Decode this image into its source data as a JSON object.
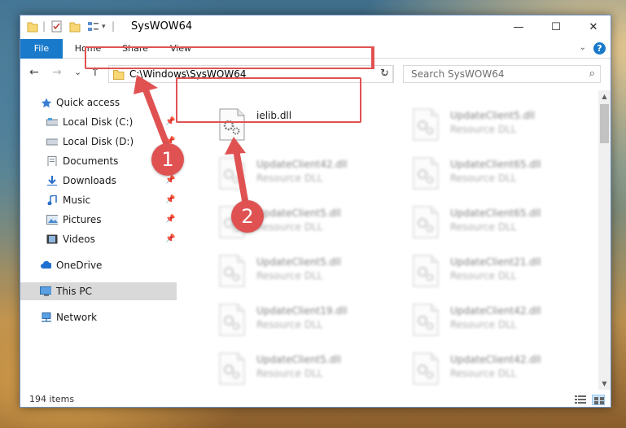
{
  "window": {
    "title": "SysWOW64",
    "minimize": "—",
    "maximize": "☐",
    "close": "✕"
  },
  "ribbon": {
    "tabs": [
      "File",
      "Home",
      "Share",
      "View"
    ],
    "expand": "⌄",
    "help": "?"
  },
  "nav": {
    "back": "←",
    "forward": "→",
    "recent": "⌄",
    "up": "↑",
    "address": "C:\\Windows\\SysWOW64",
    "address_dropdown": "⌄",
    "refresh": "↻",
    "search_placeholder": "Search SysWOW64",
    "search_icon": "⌕"
  },
  "sidebar": {
    "items": [
      {
        "label": "Quick access",
        "icon": "star-icon",
        "pinned": false
      },
      {
        "label": "Local Disk (C:)",
        "icon": "drive-icon",
        "pinned": true
      },
      {
        "label": "Local Disk (D:)",
        "icon": "drive-icon",
        "pinned": true
      },
      {
        "label": "Documents",
        "icon": "documents-icon",
        "pinned": true
      },
      {
        "label": "Downloads",
        "icon": "download-icon",
        "pinned": true
      },
      {
        "label": "Music",
        "icon": "music-icon",
        "pinned": true
      },
      {
        "label": "Pictures",
        "icon": "pictures-icon",
        "pinned": true
      },
      {
        "label": "Videos",
        "icon": "videos-icon",
        "pinned": true
      },
      {
        "label": "OneDrive",
        "icon": "cloud-icon",
        "pinned": false
      },
      {
        "label": "This PC",
        "icon": "computer-icon",
        "pinned": false,
        "selected": true
      },
      {
        "label": "Network",
        "icon": "network-icon",
        "pinned": false
      }
    ],
    "pin_glyph": "📌"
  },
  "files": [
    {
      "name": "ielib.dll",
      "type": "",
      "highlighted": true
    },
    {
      "name": "UpdateClient5.dll",
      "type": "Resource DLL"
    },
    {
      "name": "UpdateClient42.dll",
      "type": "Resource DLL"
    },
    {
      "name": "UpdateClient65.dll",
      "type": "Resource DLL"
    },
    {
      "name": "UpdateClient5.dll",
      "type": "Resource DLL"
    },
    {
      "name": "UpdateClient65.dll",
      "type": "Resource DLL"
    },
    {
      "name": "UpdateClient5.dll",
      "type": "Resource DLL"
    },
    {
      "name": "UpdateClient21.dll",
      "type": "Resource DLL"
    },
    {
      "name": "UpdateClient19.dll",
      "type": "Resource DLL"
    },
    {
      "name": "UpdateClient42.dll",
      "type": "Resource DLL"
    },
    {
      "name": "UpdateClient5.dll",
      "type": "Resource DLL"
    },
    {
      "name": "UpdateClient42.dll",
      "type": "Resource DLL"
    }
  ],
  "status": {
    "item_count": "194 items"
  },
  "callouts": [
    "1",
    "2"
  ],
  "colors": {
    "accent": "#1979ca",
    "highlight": "#e05252",
    "selected_bg": "#d9d9d9"
  }
}
